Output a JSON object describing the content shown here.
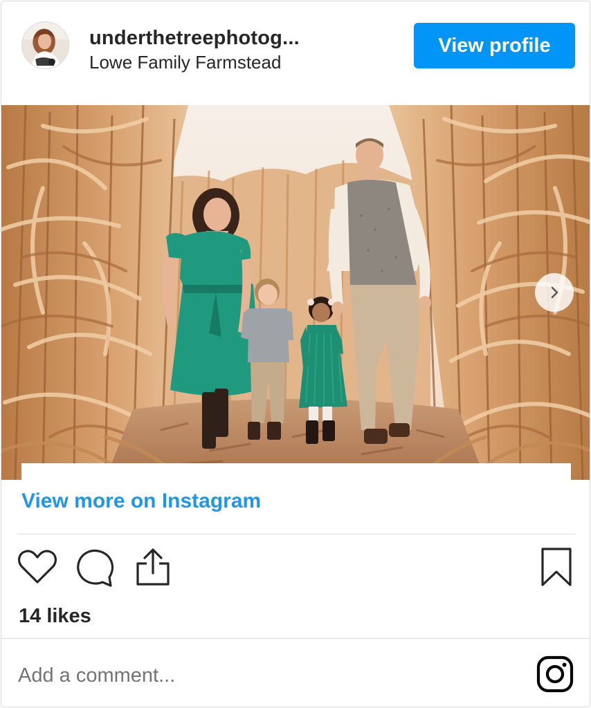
{
  "header": {
    "username": "underthetreephotog...",
    "location": "Lowe Family Farmstead",
    "view_profile_label": "View profile"
  },
  "post": {
    "image_alt": "Family of four walking hand in hand through a dried cornfield",
    "view_more_label": "View more on Instagram"
  },
  "actions": {
    "like_icon": "heart-icon",
    "comment_icon": "comment-icon",
    "share_icon": "share-icon",
    "save_icon": "bookmark-icon"
  },
  "likes": {
    "label": "14 likes"
  },
  "comment": {
    "placeholder": "Add a comment..."
  },
  "footer": {
    "logo_icon": "instagram-icon"
  },
  "colors": {
    "accent": "#0095f6",
    "link": "#1f96e6",
    "text": "#262626",
    "muted": "#737373",
    "border": "#dbdbdb"
  }
}
